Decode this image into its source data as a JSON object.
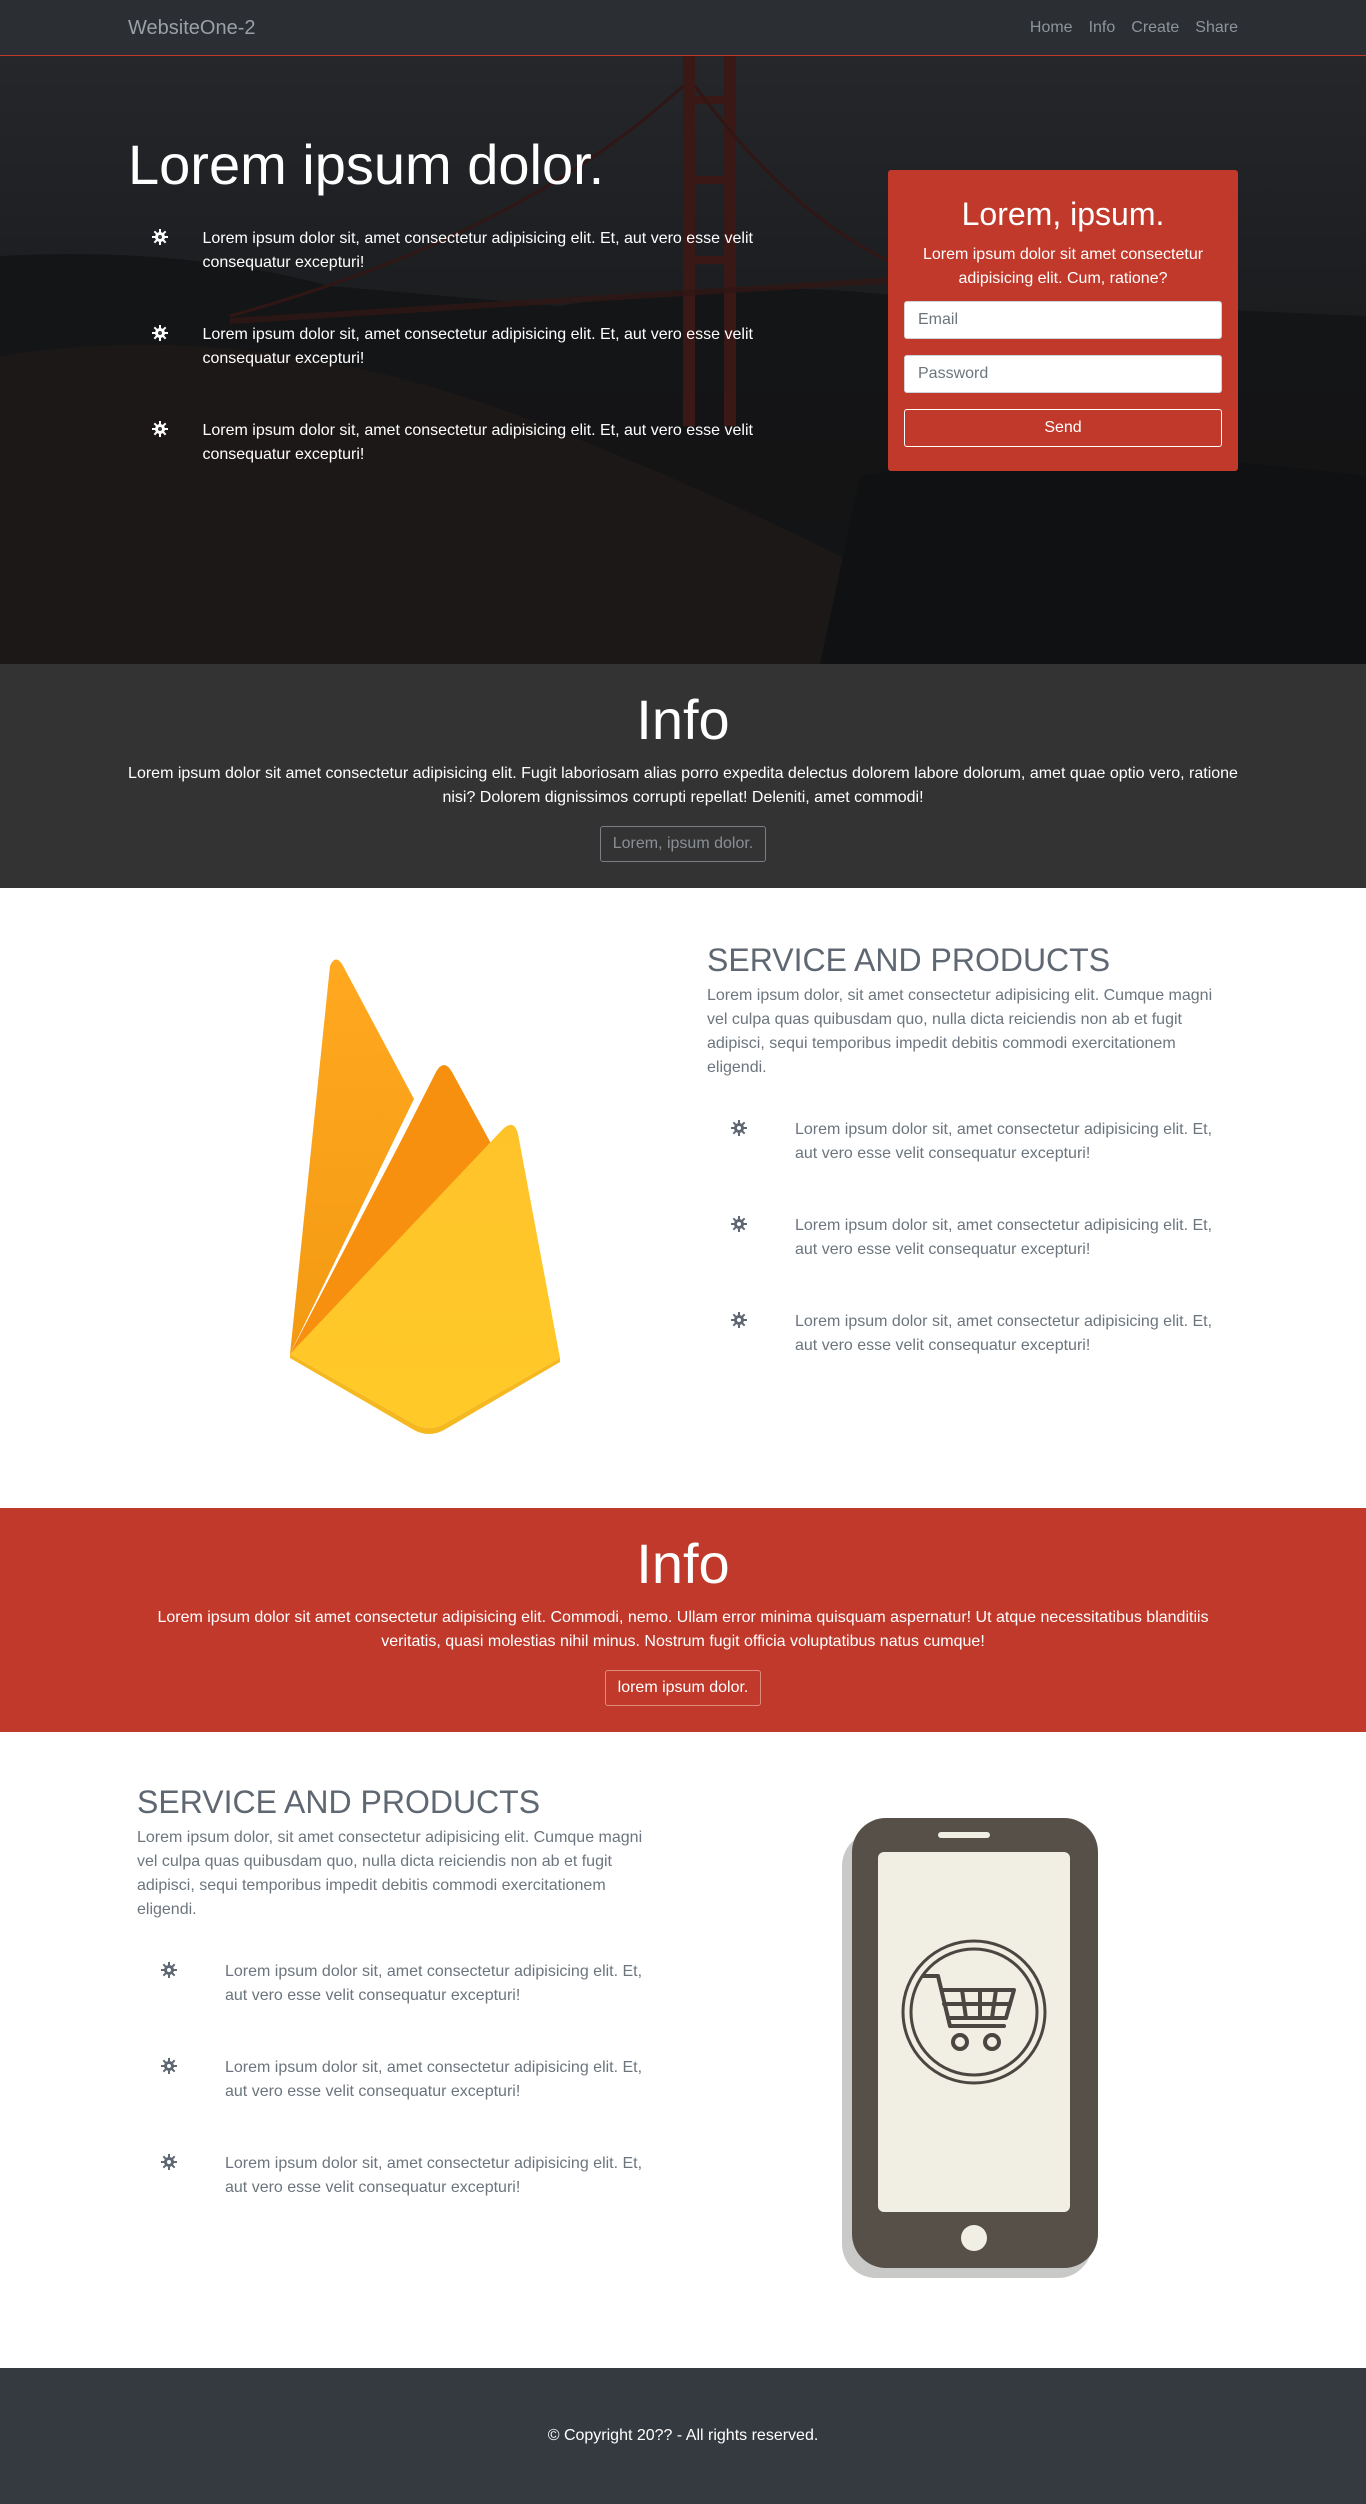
{
  "navbar": {
    "brand": "WebsiteOne-2",
    "links": [
      "Home",
      "Info",
      "Create",
      "Share"
    ]
  },
  "hero": {
    "title": "Lorem ipsum dolor.",
    "features": [
      "Lorem ipsum dolor sit, amet consectetur adipisicing elit. Et, aut vero esse velit consequatur excepturi!",
      "Lorem ipsum dolor sit, amet consectetur adipisicing elit. Et, aut vero esse velit consequatur excepturi!",
      "Lorem ipsum dolor sit, amet consectetur adipisicing elit. Et, aut vero esse velit consequatur excepturi!"
    ],
    "form": {
      "title": "Lorem, ipsum.",
      "subtitle": "Lorem ipsum dolor sit amet consectetur adipisicing elit. Cum, ratione?",
      "email_placeholder": "Email",
      "password_placeholder": "Password",
      "send_label": "Send"
    }
  },
  "info_dark": {
    "title": "Info",
    "text": "Lorem ipsum dolor sit amet consectetur adipisicing elit. Fugit laboriosam alias porro expedita delectus dolorem labore dolorum, amet quae optio vero, ratione nisi? Dolorem dignissimos corrupti repellat! Deleniti, amet commodi!",
    "button": "Lorem, ipsum dolor."
  },
  "service_1": {
    "title": "SERVICE AND PRODUCTS",
    "text": "Lorem ipsum dolor, sit amet consectetur adipisicing elit. Cumque magni vel culpa quas quibusdam quo, nulla dicta reiciendis non ab et fugit adipisci, sequi temporibus impedit debitis commodi exercitationem eligendi.",
    "features": [
      "Lorem ipsum dolor sit, amet consectetur adipisicing elit. Et, aut vero esse velit consequatur excepturi!",
      "Lorem ipsum dolor sit, amet consectetur adipisicing elit. Et, aut vero esse velit consequatur excepturi!",
      "Lorem ipsum dolor sit, amet consectetur adipisicing elit. Et, aut vero esse velit consequatur excepturi!"
    ]
  },
  "info_red": {
    "title": "Info",
    "text": "Lorem ipsum dolor sit amet consectetur adipisicing elit. Commodi, nemo. Ullam error minima quisquam aspernatur! Ut atque necessitatibus blanditiis veritatis, quasi molestias nihil minus. Nostrum fugit officia voluptatibus natus cumque!",
    "button": "lorem ipsum dolor."
  },
  "service_2": {
    "title": "SERVICE AND PRODUCTS",
    "text": "Lorem ipsum dolor, sit amet consectetur adipisicing elit. Cumque magni vel culpa quas quibusdam quo, nulla dicta reiciendis non ab et fugit adipisci, sequi temporibus impedit debitis commodi exercitationem eligendi.",
    "features": [
      "Lorem ipsum dolor sit, amet consectetur adipisicing elit. Et, aut vero esse velit consequatur excepturi!",
      "Lorem ipsum dolor sit, amet consectetur adipisicing elit. Et, aut vero esse velit consequatur excepturi!",
      "Lorem ipsum dolor sit, amet consectetur adipisicing elit. Et, aut vero esse velit consequatur excepturi!"
    ]
  },
  "footer": {
    "copyright": "© Copyright 20?? - All rights reserved."
  },
  "colors": {
    "accent": "#c0392b",
    "navbar": "#2b2e33",
    "info_dark": "#333333",
    "footer": "#343a40",
    "text_muted": "#6c757d"
  },
  "icons": {
    "feature": "gear-icon",
    "service_1_illustration": "firebase-flame-logo",
    "service_2_illustration": "smartphone-shopping-cart-icon"
  }
}
